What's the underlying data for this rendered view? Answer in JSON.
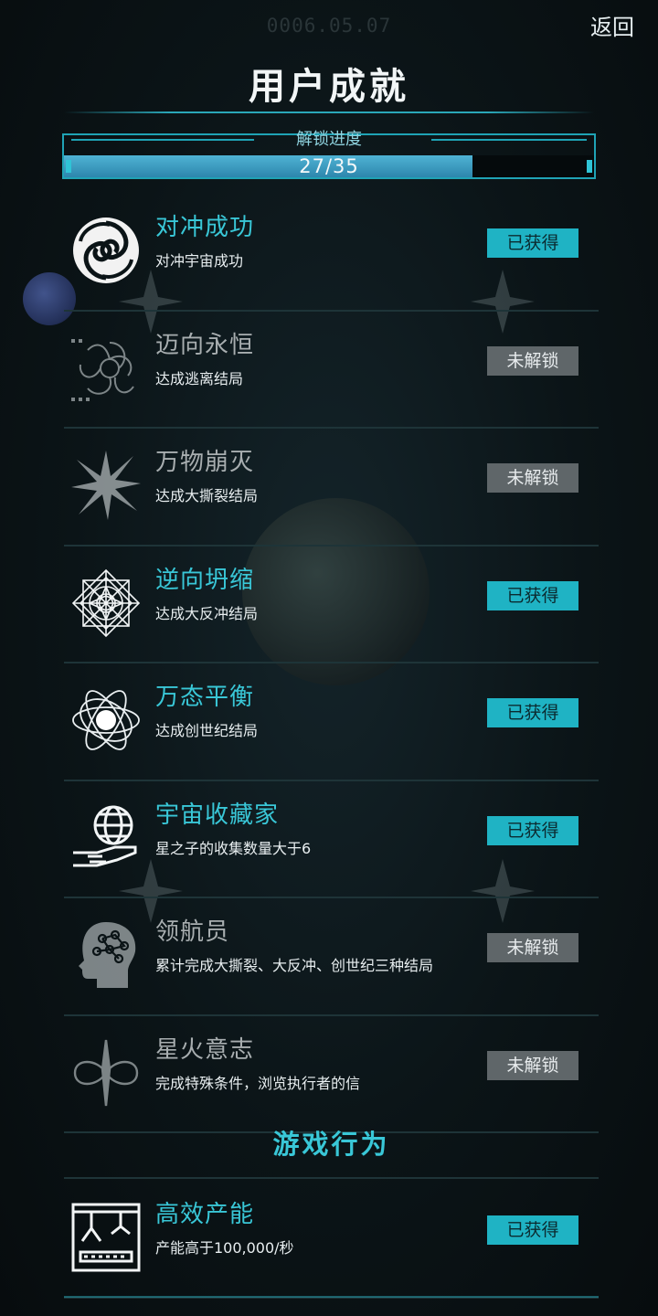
{
  "header": {
    "date": "0006.05.07",
    "back_label": "返回",
    "title": "用户成就"
  },
  "progress": {
    "label": "解锁进度",
    "text": "27/35",
    "unlocked": 27,
    "total": 35,
    "fill_color": "#3fa3cb"
  },
  "colors": {
    "accent": "#39c7d7",
    "got_button": "#1fb3c4",
    "locked_button": "#5f6669"
  },
  "achievements": [
    {
      "name": "对冲成功",
      "desc": "对冲宇宙成功",
      "status": "已获得",
      "icon": "spiral-vortex-icon"
    },
    {
      "name": "迈向永恒",
      "desc": "达成逃离结局",
      "status": "未解锁",
      "icon": "swirl-galaxy-icon"
    },
    {
      "name": "万物崩灭",
      "desc": "达成大撕裂结局",
      "status": "未解锁",
      "icon": "burst-star-icon"
    },
    {
      "name": "逆向坍缩",
      "desc": "达成大反冲结局",
      "status": "已获得",
      "icon": "crystal-flower-icon"
    },
    {
      "name": "万态平衡",
      "desc": "达成创世纪结局",
      "status": "已获得",
      "icon": "atom-orbit-icon"
    },
    {
      "name": "宇宙收藏家",
      "desc": "星之子的收集数量大于6",
      "status": "已获得",
      "icon": "hand-globe-icon"
    },
    {
      "name": "领航员",
      "desc": "累计完成大撕裂、大反冲、创世纪三种结局",
      "status": "未解锁",
      "icon": "brain-head-icon"
    },
    {
      "name": "星火意志",
      "desc": "完成特殊条件，浏览执行者的信",
      "status": "未解锁",
      "icon": "infinity-knot-icon"
    }
  ],
  "section": {
    "title": "游戏行为"
  },
  "behaviors": [
    {
      "name": "高效产能",
      "desc": "产能高于100,000/秒",
      "status": "已获得",
      "icon": "factory-arm-icon"
    }
  ]
}
